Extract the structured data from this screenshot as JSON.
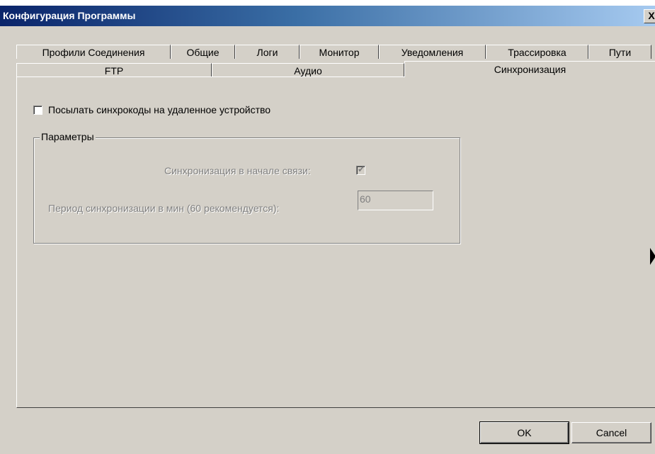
{
  "window": {
    "title": "Конфигурация Программы",
    "close_glyph": "X"
  },
  "tabs_row1": [
    "Профили Соединения",
    "Общие",
    "Логи",
    "Монитор",
    "Уведомления",
    "Трассировка",
    "Пути"
  ],
  "tabs_row2": [
    "FTP",
    "Аудио",
    "Синхронизация"
  ],
  "active_tab": "Синхронизация",
  "sync": {
    "send_checkbox_label": "Посылать синхрокоды на удаленное устройство",
    "send_checked": false,
    "group_title": "Параметры",
    "sync_at_start_label": "Синхронизация в начале связи:",
    "sync_at_start_checked": true,
    "period_label": "Период синхронизации в мин (60 рекомендуется):",
    "period_value": "60"
  },
  "buttons": {
    "ok": "OK",
    "cancel": "Cancel"
  }
}
